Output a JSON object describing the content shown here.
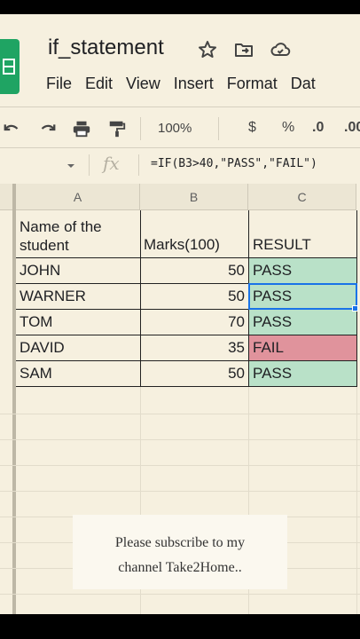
{
  "app": {
    "doc_title": "if_statement",
    "logo_color": "#1fa463"
  },
  "menu": [
    "File",
    "Edit",
    "View",
    "Insert",
    "Format",
    "Dat"
  ],
  "toolbar": {
    "zoom": "100%",
    "currency": "$",
    "percent": "%",
    "decrease_decimal": ".0",
    "increase_decimal": ".00",
    "icons": [
      "undo-icon",
      "redo-icon",
      "print-icon",
      "paint-format-icon"
    ]
  },
  "formula_bar": {
    "fx_label": "fx",
    "formula": "=IF(B3>40,\"PASS\",\"FAIL\")"
  },
  "columns": [
    "A",
    "B",
    "C"
  ],
  "sheet": {
    "header": {
      "name_line1": "Name of the",
      "name_line2": "student",
      "marks": "Marks(100)",
      "result": "RESULT"
    },
    "rows": [
      {
        "name": "JOHN",
        "marks": "50",
        "result": "PASS"
      },
      {
        "name": "WARNER",
        "marks": "50",
        "result": "PASS"
      },
      {
        "name": "TOM",
        "marks": "70",
        "result": "PASS"
      },
      {
        "name": "DAVID",
        "marks": "35",
        "result": "FAIL"
      },
      {
        "name": "SAM",
        "marks": "50",
        "result": "PASS"
      }
    ],
    "selected_cell": "C3"
  },
  "colors": {
    "pass_fill": "#b9e1c8",
    "fail_fill": "#e0939c",
    "selection": "#1a73e8"
  },
  "overlay": {
    "line1": "Please subscribe to my",
    "line2": "channel Take2Home.."
  }
}
